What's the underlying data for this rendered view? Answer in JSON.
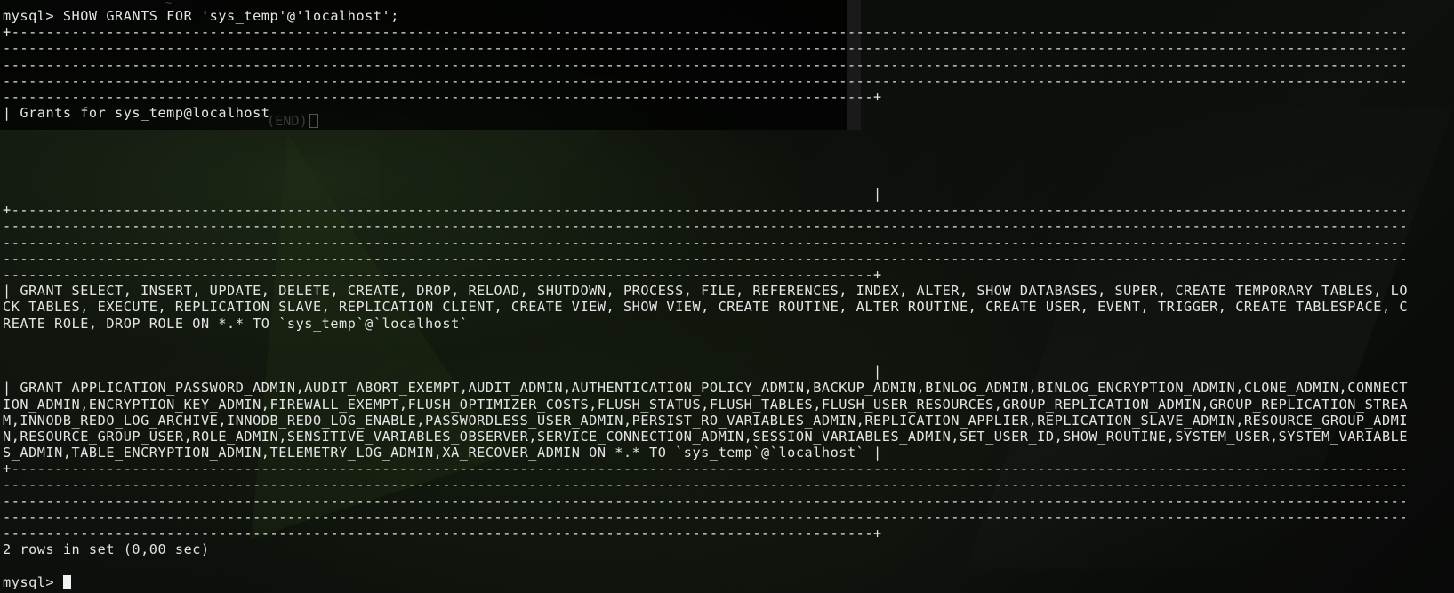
{
  "terminal": {
    "ghost": {
      "tilde": "~",
      "end_marker": "(END)"
    },
    "lines": [
      "mysql> SHOW GRANTS FOR 'sys_temp'@'localhost';",
      "+------------------------------------------------------------------------------------------------------------------------------------------------------------------",
      "-------------------------------------------------------------------------------------------------------------------------------------------------------------------",
      "-------------------------------------------------------------------------------------------------------------------------------------------------------------------",
      "-------------------------------------------------------------------------------------------------------------------------------------------------------------------",
      "-----------------------------------------------------------------------------------------------------+",
      "| Grants for sys_temp@localhost",
      "",
      "",
      "",
      "",
      "                                                                                                     |",
      "+------------------------------------------------------------------------------------------------------------------------------------------------------------------",
      "-------------------------------------------------------------------------------------------------------------------------------------------------------------------",
      "-------------------------------------------------------------------------------------------------------------------------------------------------------------------",
      "-------------------------------------------------------------------------------------------------------------------------------------------------------------------",
      "-----------------------------------------------------------------------------------------------------+",
      "| GRANT SELECT, INSERT, UPDATE, DELETE, CREATE, DROP, RELOAD, SHUTDOWN, PROCESS, FILE, REFERENCES, INDEX, ALTER, SHOW DATABASES, SUPER, CREATE TEMPORARY TABLES, LO",
      "CK TABLES, EXECUTE, REPLICATION SLAVE, REPLICATION CLIENT, CREATE VIEW, SHOW VIEW, CREATE ROUTINE, ALTER ROUTINE, CREATE USER, EVENT, TRIGGER, CREATE TABLESPACE, C",
      "REATE ROLE, DROP ROLE ON *.* TO `sys_temp`@`localhost`",
      "",
      "",
      "                                                                                                     |",
      "| GRANT APPLICATION_PASSWORD_ADMIN,AUDIT_ABORT_EXEMPT,AUDIT_ADMIN,AUTHENTICATION_POLICY_ADMIN,BACKUP_ADMIN,BINLOG_ADMIN,BINLOG_ENCRYPTION_ADMIN,CLONE_ADMIN,CONNECT",
      "ION_ADMIN,ENCRYPTION_KEY_ADMIN,FIREWALL_EXEMPT,FLUSH_OPTIMIZER_COSTS,FLUSH_STATUS,FLUSH_TABLES,FLUSH_USER_RESOURCES,GROUP_REPLICATION_ADMIN,GROUP_REPLICATION_STREA",
      "M,INNODB_REDO_LOG_ARCHIVE,INNODB_REDO_LOG_ENABLE,PASSWORDLESS_USER_ADMIN,PERSIST_RO_VARIABLES_ADMIN,REPLICATION_APPLIER,REPLICATION_SLAVE_ADMIN,RESOURCE_GROUP_ADMI",
      "N,RESOURCE_GROUP_USER,ROLE_ADMIN,SENSITIVE_VARIABLES_OBSERVER,SERVICE_CONNECTION_ADMIN,SESSION_VARIABLES_ADMIN,SET_USER_ID,SHOW_ROUTINE,SYSTEM_USER,SYSTEM_VARIABLE",
      "S_ADMIN,TABLE_ENCRYPTION_ADMIN,TELEMETRY_LOG_ADMIN,XA_RECOVER_ADMIN ON *.* TO `sys_temp`@`localhost` |",
      "+------------------------------------------------------------------------------------------------------------------------------------------------------------------",
      "-------------------------------------------------------------------------------------------------------------------------------------------------------------------",
      "-------------------------------------------------------------------------------------------------------------------------------------------------------------------",
      "-------------------------------------------------------------------------------------------------------------------------------------------------------------------",
      "-----------------------------------------------------------------------------------------------------+",
      "2 rows in set (0,00 sec)",
      ""
    ],
    "prompt": "mysql> "
  }
}
